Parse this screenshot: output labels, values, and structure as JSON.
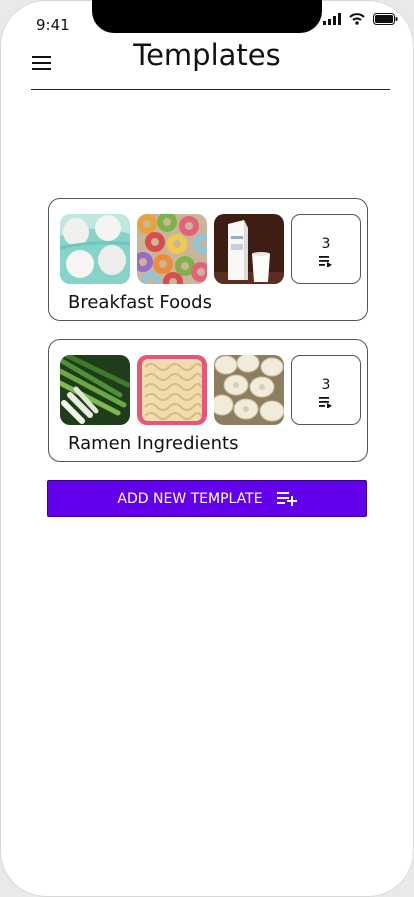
{
  "status_bar": {
    "time": "9:41"
  },
  "header": {
    "title": "Templates"
  },
  "templates": [
    {
      "name": "Breakfast Foods",
      "count": "3",
      "thumbnails": [
        "eggs-image",
        "cereal-image",
        "milk-image"
      ]
    },
    {
      "name": "Ramen Ingredients",
      "count": "3",
      "thumbnails": [
        "green-onions-image",
        "ramen-noodles-image",
        "mushrooms-image"
      ]
    }
  ],
  "actions": {
    "add_template_label": "ADD NEW TEMPLATE"
  },
  "colors": {
    "accent": "#6200ee",
    "text": "#111111",
    "border": "#555555"
  }
}
